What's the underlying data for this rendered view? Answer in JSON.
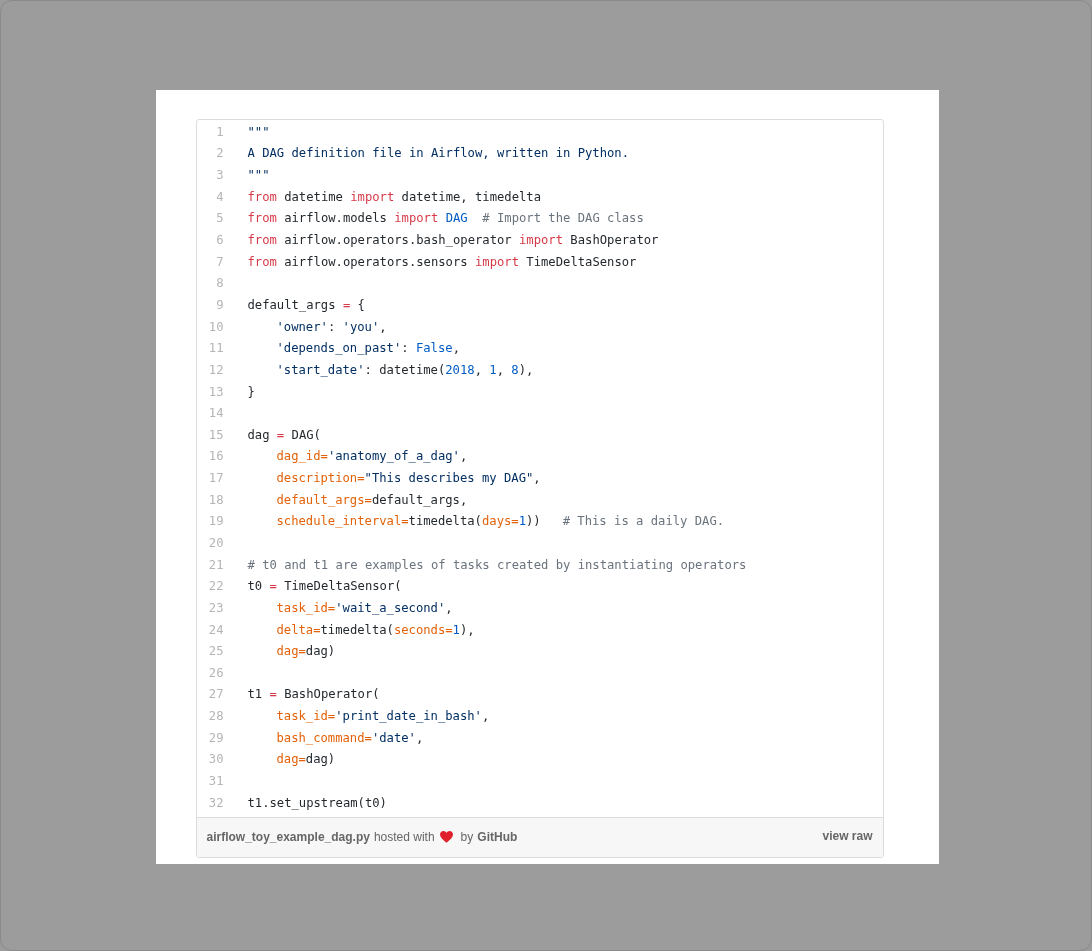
{
  "code": {
    "lines": [
      {
        "n": "1",
        "tokens": [
          {
            "t": "\"\"\"",
            "kind": "string"
          }
        ]
      },
      {
        "n": "2",
        "tokens": [
          {
            "t": "A DAG definition file in Airflow, written in Python.",
            "kind": "string"
          }
        ]
      },
      {
        "n": "3",
        "tokens": [
          {
            "t": "\"\"\"",
            "kind": "string"
          }
        ]
      },
      {
        "n": "4",
        "tokens": [
          {
            "t": "from",
            "kind": "keyword"
          },
          {
            "t": " datetime ",
            "kind": "plain"
          },
          {
            "t": "import",
            "kind": "keyword"
          },
          {
            "t": " datetime, timedelta",
            "kind": "plain"
          }
        ]
      },
      {
        "n": "5",
        "tokens": [
          {
            "t": "from",
            "kind": "keyword"
          },
          {
            "t": " airflow.models ",
            "kind": "plain"
          },
          {
            "t": "import",
            "kind": "keyword"
          },
          {
            "t": " DAG",
            "kind": "constant"
          },
          {
            "t": "  # Import the DAG class",
            "kind": "comment"
          }
        ]
      },
      {
        "n": "6",
        "tokens": [
          {
            "t": "from",
            "kind": "keyword"
          },
          {
            "t": " airflow.operators.bash_operator ",
            "kind": "plain"
          },
          {
            "t": "import",
            "kind": "keyword"
          },
          {
            "t": " BashOperator",
            "kind": "plain"
          }
        ]
      },
      {
        "n": "7",
        "tokens": [
          {
            "t": "from",
            "kind": "keyword"
          },
          {
            "t": " airflow.operators.sensors ",
            "kind": "plain"
          },
          {
            "t": "import",
            "kind": "keyword"
          },
          {
            "t": " TimeDeltaSensor",
            "kind": "plain"
          }
        ]
      },
      {
        "n": "8"
      },
      {
        "n": "9",
        "tokens": [
          {
            "t": "default_args ",
            "kind": "plain"
          },
          {
            "t": "=",
            "kind": "operator"
          },
          {
            "t": " {",
            "kind": "plain"
          }
        ]
      },
      {
        "n": "10",
        "indented": true,
        "tokens": [
          {
            "t": "'owner'",
            "kind": "string"
          },
          {
            "t": ": ",
            "kind": "plain"
          },
          {
            "t": "'you'",
            "kind": "string"
          },
          {
            "t": ",",
            "kind": "plain"
          }
        ]
      },
      {
        "n": "11",
        "indented": true,
        "tokens": [
          {
            "t": "'depends_on_past'",
            "kind": "string"
          },
          {
            "t": ": ",
            "kind": "plain"
          },
          {
            "t": "False",
            "kind": "constant"
          },
          {
            "t": ",",
            "kind": "plain"
          }
        ]
      },
      {
        "n": "12",
        "indented": true,
        "tokens": [
          {
            "t": "'start_date'",
            "kind": "string"
          },
          {
            "t": ": datetime(",
            "kind": "plain"
          },
          {
            "t": "2018",
            "kind": "constant"
          },
          {
            "t": ", ",
            "kind": "plain"
          },
          {
            "t": "1",
            "kind": "constant"
          },
          {
            "t": ", ",
            "kind": "plain"
          },
          {
            "t": "8",
            "kind": "constant"
          },
          {
            "t": "),",
            "kind": "plain"
          }
        ]
      },
      {
        "n": "13",
        "tokens": [
          {
            "t": "}",
            "kind": "plain"
          }
        ]
      },
      {
        "n": "14"
      },
      {
        "n": "15",
        "tokens": [
          {
            "t": "dag ",
            "kind": "plain"
          },
          {
            "t": "=",
            "kind": "operator"
          },
          {
            "t": " DAG(",
            "kind": "plain"
          }
        ]
      },
      {
        "n": "16",
        "indented": true,
        "tokens": [
          {
            "t": "dag_id=",
            "kind": "argument"
          },
          {
            "t": "'anatomy_of_a_dag'",
            "kind": "string"
          },
          {
            "t": ",",
            "kind": "plain"
          }
        ]
      },
      {
        "n": "17",
        "indented": true,
        "tokens": [
          {
            "t": "description=",
            "kind": "argument"
          },
          {
            "t": "\"This describes my DAG\"",
            "kind": "string"
          },
          {
            "t": ",",
            "kind": "plain"
          }
        ]
      },
      {
        "n": "18",
        "indented": true,
        "tokens": [
          {
            "t": "default_args=",
            "kind": "argument"
          },
          {
            "t": "default_args,",
            "kind": "plain"
          }
        ]
      },
      {
        "n": "19",
        "indented": true,
        "tokens": [
          {
            "t": "schedule_interval=",
            "kind": "argument"
          },
          {
            "t": "timedelta(",
            "kind": "plain"
          },
          {
            "t": "days=",
            "kind": "argument"
          },
          {
            "t": "1",
            "kind": "constant"
          },
          {
            "t": "))",
            "kind": "plain"
          },
          {
            "t": "   # This is a daily DAG.",
            "kind": "comment"
          }
        ]
      },
      {
        "n": "20"
      },
      {
        "n": "21",
        "tokens": [
          {
            "t": "# t0 and t1 are examples of tasks created by instantiating operators",
            "kind": "comment"
          }
        ]
      },
      {
        "n": "22",
        "tokens": [
          {
            "t": "t0 ",
            "kind": "plain"
          },
          {
            "t": "=",
            "kind": "operator"
          },
          {
            "t": " TimeDeltaSensor(",
            "kind": "plain"
          }
        ]
      },
      {
        "n": "23",
        "indented": true,
        "tokens": [
          {
            "t": "task_id=",
            "kind": "argument"
          },
          {
            "t": "'wait_a_second'",
            "kind": "string"
          },
          {
            "t": ",",
            "kind": "plain"
          }
        ]
      },
      {
        "n": "24",
        "indented": true,
        "tokens": [
          {
            "t": "delta=",
            "kind": "argument"
          },
          {
            "t": "timedelta(",
            "kind": "plain"
          },
          {
            "t": "seconds=",
            "kind": "argument"
          },
          {
            "t": "1",
            "kind": "constant"
          },
          {
            "t": "),",
            "kind": "plain"
          }
        ]
      },
      {
        "n": "25",
        "indented": true,
        "tokens": [
          {
            "t": "dag=",
            "kind": "argument"
          },
          {
            "t": "dag)",
            "kind": "plain"
          }
        ]
      },
      {
        "n": "26"
      },
      {
        "n": "27",
        "tokens": [
          {
            "t": "t1 ",
            "kind": "plain"
          },
          {
            "t": "=",
            "kind": "operator"
          },
          {
            "t": " BashOperator(",
            "kind": "plain"
          }
        ]
      },
      {
        "n": "28",
        "indented": true,
        "tokens": [
          {
            "t": "task_id=",
            "kind": "argument"
          },
          {
            "t": "'print_date_in_bash'",
            "kind": "string"
          },
          {
            "t": ",",
            "kind": "plain"
          }
        ]
      },
      {
        "n": "29",
        "indented": true,
        "tokens": [
          {
            "t": "bash_command=",
            "kind": "argument"
          },
          {
            "t": "'date'",
            "kind": "string"
          },
          {
            "t": ",",
            "kind": "plain"
          }
        ]
      },
      {
        "n": "30",
        "indented": true,
        "tokens": [
          {
            "t": "dag=",
            "kind": "argument"
          },
          {
            "t": "dag)",
            "kind": "plain"
          }
        ]
      },
      {
        "n": "31"
      },
      {
        "n": "32",
        "tokens": [
          {
            "t": "t1.set_upstream(t0)",
            "kind": "plain"
          }
        ]
      }
    ]
  },
  "footer": {
    "file_link": "airflow_toy_example_dag.py",
    "hosted_text": "hosted with",
    "by_text": "by",
    "host_link": "GitHub",
    "raw_link": "view raw"
  }
}
